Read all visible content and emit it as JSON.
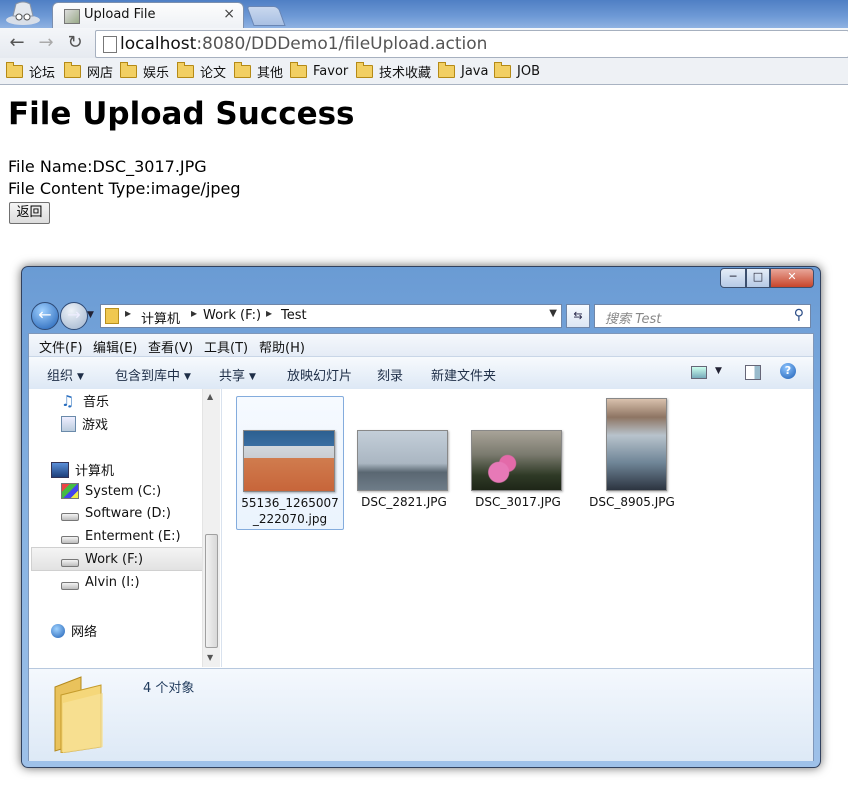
{
  "browser": {
    "tab_title": "Upload File",
    "tab_close": "×",
    "url_host": "localhost",
    "url_rest": ":8080/DDDemo1/fileUpload.action",
    "bookmarks": [
      "论坛",
      "网店",
      "娱乐",
      "论文",
      "其他",
      "Favor",
      "技术收藏",
      "Java",
      "JOB"
    ]
  },
  "page": {
    "heading": "File Upload Success",
    "file_name_line": "File Name:DSC_3017.JPG",
    "content_type_line": "File Content Type:image/jpeg",
    "back_button": "返回"
  },
  "explorer": {
    "breadcrumb": [
      "计算机",
      "Work (F:)",
      "Test"
    ],
    "search_placeholder": "搜索 Test",
    "menu": [
      "文件(F)",
      "编辑(E)",
      "查看(V)",
      "工具(T)",
      "帮助(H)"
    ],
    "commands": {
      "organize": "组织",
      "include": "包含到库中",
      "share": "共享",
      "slideshow": "放映幻灯片",
      "burn": "刻录",
      "new_folder": "新建文件夹"
    },
    "nav": {
      "music": "音乐",
      "games": "游戏",
      "computer": "计算机",
      "drives": [
        "System (C:)",
        "Software (D:)",
        "Enterment (E:)",
        "Work (F:)",
        "Alvin (I:)"
      ],
      "network": "网络"
    },
    "files": [
      {
        "line1": "55136_1265007",
        "line2": "_222070.jpg"
      },
      {
        "line1": "DSC_2821.JPG",
        "line2": ""
      },
      {
        "line1": "DSC_3017.JPG",
        "line2": ""
      },
      {
        "line1": "DSC_8905.JPG",
        "line2": ""
      }
    ],
    "status_count": "4 个对象"
  }
}
